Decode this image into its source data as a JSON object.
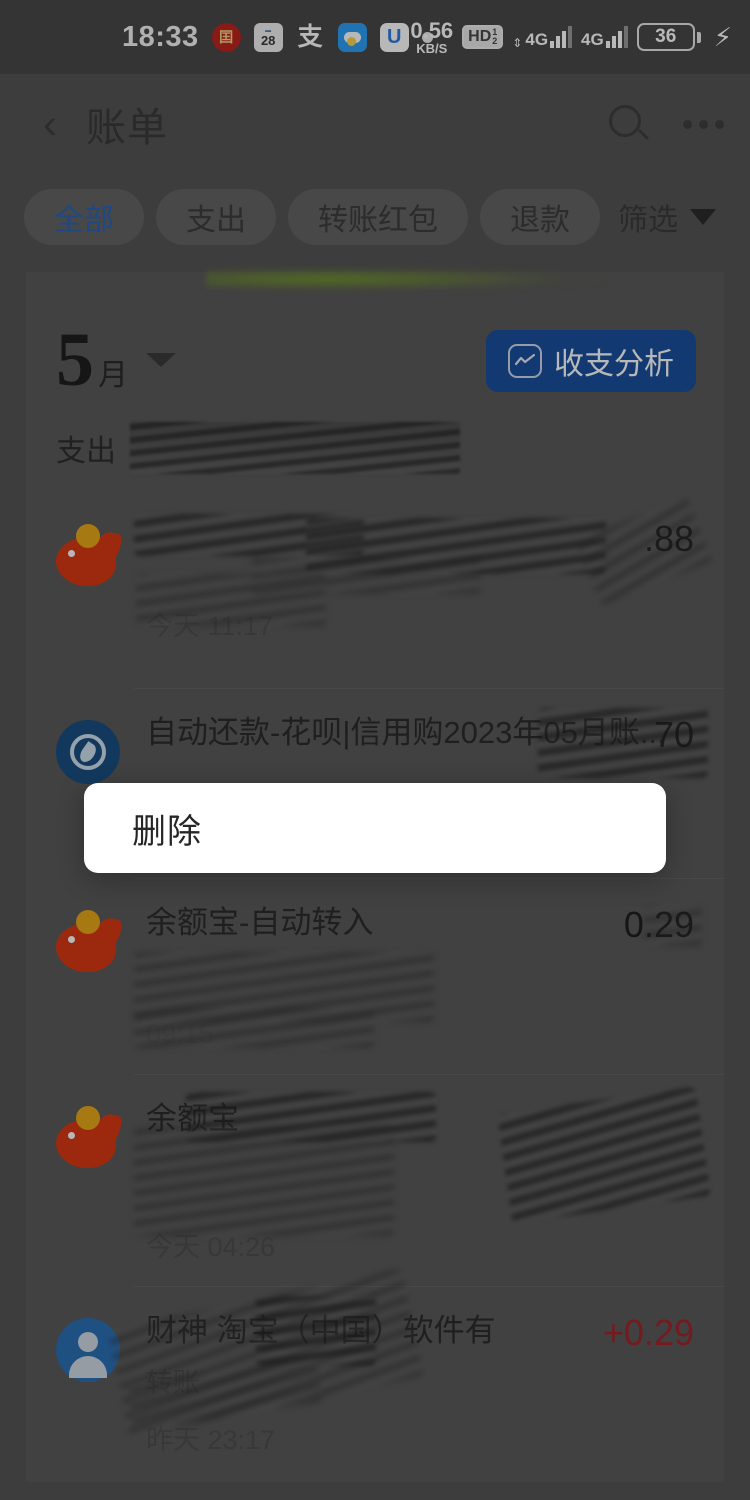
{
  "statusbar": {
    "time": "18:33",
    "tray_icons": [
      "red-seal-app-icon",
      "calendar-28-icon",
      "alipay-icon",
      "weather-cloudy-icon",
      "app-u-icon",
      "dot-icon"
    ],
    "calendar_day": "28",
    "alipay_glyph": "支",
    "app_u_glyph": "U",
    "net_speed_value": "0.56",
    "net_speed_unit": "KB/S",
    "hd_label": "HD",
    "hd_sub_top": "1",
    "hd_sub_bottom": "2",
    "sim1_network": "4G",
    "sim2_network": "4G",
    "battery_level": "36",
    "charging": true
  },
  "navbar": {
    "back_icon": "chevron-left-icon",
    "title": "账单",
    "search_icon": "search-icon",
    "more_icon": "more-horizontal-icon"
  },
  "tabs": {
    "items": [
      {
        "label": "全部",
        "active": true
      },
      {
        "label": "支出",
        "active": false
      },
      {
        "label": "转账红包",
        "active": false
      },
      {
        "label": "退款",
        "active": false
      }
    ],
    "filter_label": "筛选",
    "filter_caret": "caret-down-icon"
  },
  "month_summary": {
    "month_number": "5",
    "month_unit": "月",
    "dropdown_icon": "caret-down-icon",
    "expense_label": "支出",
    "expense_value_redacted": "",
    "analysis_button": {
      "label": "收支分析",
      "icon": "chart-trend-icon",
      "color": "#1a4f9e"
    }
  },
  "transactions": [
    {
      "avatar": "yuebao-fish-icon",
      "title": "",
      "title_redacted": true,
      "subtitle": "",
      "subtitle_redacted": true,
      "time": "今天 11:17",
      "amount": ".88",
      "amount_redacted": true,
      "amount_type": "expense"
    },
    {
      "avatar": "huabei-icon",
      "title": "自动还款-花呗|信用购2023年05月账...",
      "title_redacted": false,
      "subtitle": "",
      "subtitle_redacted": false,
      "time": "",
      "amount": "70",
      "amount_redacted": true,
      "amount_type": "expense"
    },
    {
      "avatar": "yuebao-fish-icon",
      "title": "余额宝-自动转入",
      "title_redacted": false,
      "subtitle": "",
      "subtitle_redacted": true,
      "time": "09:15",
      "time_redacted": true,
      "amount": "0.29",
      "amount_redacted": true,
      "amount_type": "expense"
    },
    {
      "avatar": "yuebao-fish-icon",
      "title": "余额宝",
      "title_redacted": true,
      "subtitle": "",
      "subtitle_redacted": true,
      "time": "今天 04:26",
      "amount": "",
      "amount_redacted": true,
      "amount_type": "expense"
    },
    {
      "avatar": "person-avatar-icon",
      "title": "财神 淘宝（中国）软件有",
      "title_redacted": true,
      "subtitle": "转账",
      "subtitle_redacted": true,
      "time": "昨天 23:17",
      "amount": "+0.29",
      "amount_redacted": false,
      "amount_type": "income"
    }
  ],
  "delete_popup": {
    "label": "删除"
  },
  "colors": {
    "accent_blue": "#1a4f9e",
    "tab_active": "#2a66b8",
    "income_red": "#a3242a",
    "yuebao_red": "#d93a12",
    "huabei_blue": "#1a4f81"
  }
}
